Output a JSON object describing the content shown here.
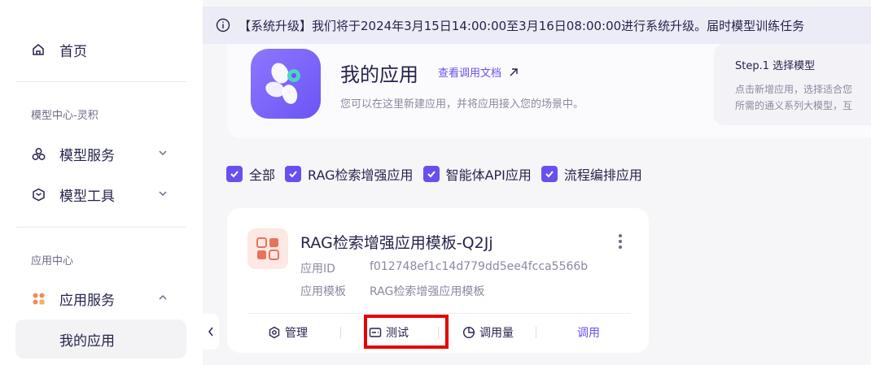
{
  "sidebar": {
    "home_label": "首页",
    "section_model_center": "模型中心-灵积",
    "model_service_label": "模型服务",
    "model_tools_label": "模型工具",
    "section_app_center": "应用中心",
    "app_service_label": "应用服务",
    "my_apps_label": "我的应用"
  },
  "notice": {
    "text": "【系统升级】我们将于2024年3月15日14:00:00至3月16日08:00:00进行系统升级。届时模型训练任务"
  },
  "hero": {
    "title": "我的应用",
    "doc_link": "查看调用文档",
    "description": "您可以在这里新建应用，并将应用接入您的场景中。",
    "step_title": "Step.1 选择模型",
    "step_desc_line1": "点击新增应用，选择适合您",
    "step_desc_line2": "所需的通义系列大模型，互"
  },
  "filters": [
    {
      "label": "全部",
      "checked": true
    },
    {
      "label": "RAG检索增强应用",
      "checked": true
    },
    {
      "label": "智能体API应用",
      "checked": true
    },
    {
      "label": "流程编排应用",
      "checked": true
    }
  ],
  "app_card": {
    "name": "RAG检索增强应用模板-Q2Jj",
    "id_label": "应用ID",
    "id_value": "f012748ef1c14d779dd5ee4fcca5566b",
    "template_label": "应用模板",
    "template_value": "RAG检索增强应用模板",
    "actions": {
      "manage": "管理",
      "test": "测试",
      "usage": "调用量",
      "invoke": "调用"
    }
  },
  "colors": {
    "accent": "#6a4ff0",
    "highlight": "#e60000"
  }
}
